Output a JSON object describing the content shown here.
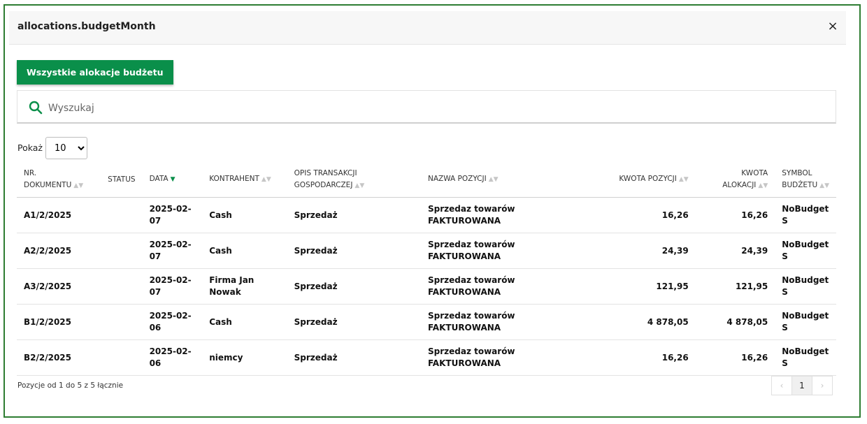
{
  "modal": {
    "title": "allocations.budgetMonth",
    "close": "×"
  },
  "toolbar": {
    "all_allocations_label": "Wszystkie alokacje budżetu"
  },
  "search": {
    "placeholder": "Wyszukaj",
    "value": ""
  },
  "show": {
    "label": "Pokaż",
    "selected": "10"
  },
  "table": {
    "headers": [
      "NR. DOKUMENTU",
      "STATUS",
      "DATA",
      "KONTRAHENT",
      "OPIS TRANSAKCJI GOSPODARCZEJ",
      "NAZWA POZYCJI",
      "KWOTA POZYCJI",
      "KWOTA ALOKACJI",
      "SYMBOL BUDŻETU"
    ],
    "rows": [
      [
        "A1/2/2025",
        "",
        "2025-02-07",
        "Cash",
        "Sprzedaż",
        "Sprzedaz towarów FAKTUROWANA",
        "16,26",
        "16,26",
        "NoBudget S"
      ],
      [
        "A2/2/2025",
        "",
        "2025-02-07",
        "Cash",
        "Sprzedaż",
        "Sprzedaz towarów FAKTUROWANA",
        "24,39",
        "24,39",
        "NoBudget S"
      ],
      [
        "A3/2/2025",
        "",
        "2025-02-07",
        "Firma Jan Nowak",
        "Sprzedaż",
        "Sprzedaz towarów FAKTUROWANA",
        "121,95",
        "121,95",
        "NoBudget S"
      ],
      [
        "B1/2/2025",
        "",
        "2025-02-06",
        "Cash",
        "Sprzedaż",
        "Sprzedaz towarów FAKTUROWANA",
        "4 878,05",
        "4 878,05",
        "NoBudget S"
      ],
      [
        "B2/2/2025",
        "",
        "2025-02-06",
        "niemcy",
        "Sprzedaż",
        "Sprzedaz towarów FAKTUROWANA",
        "16,26",
        "16,26",
        "NoBudget S"
      ]
    ]
  },
  "footer": {
    "info": "Pozycje od 1 do 5 z 5 łącznie",
    "prev": "‹",
    "page": "1",
    "next": "›"
  },
  "colors": {
    "accent": "#0a8f4a",
    "frame": "#2e7d32"
  }
}
